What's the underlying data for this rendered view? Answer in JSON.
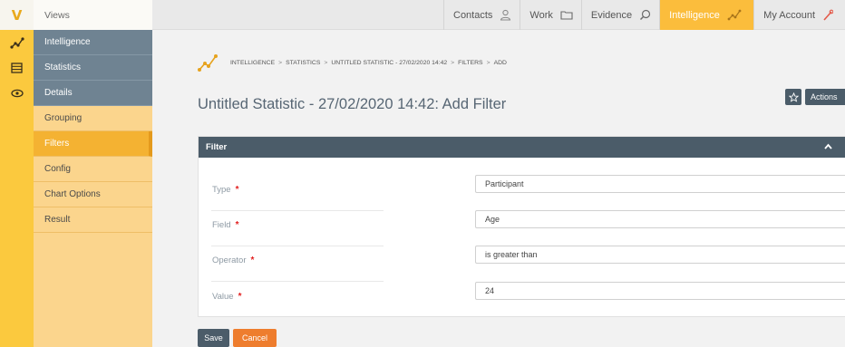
{
  "rail": {
    "logo_text": "V",
    "icons": [
      "logo-icon",
      "intelligence-icon",
      "statistics-icon",
      "details-eye-icon"
    ]
  },
  "nav": {
    "views_label": "Views",
    "items": [
      {
        "label": "Intelligence",
        "state": "section"
      },
      {
        "label": "Statistics",
        "state": "section"
      },
      {
        "label": "Details",
        "state": "section"
      },
      {
        "label": "Grouping",
        "state": "sub"
      },
      {
        "label": "Filters",
        "state": "active"
      },
      {
        "label": "Config",
        "state": "sub"
      },
      {
        "label": "Chart Options",
        "state": "sub"
      },
      {
        "label": "Result",
        "state": "sub"
      }
    ]
  },
  "topnav": {
    "items": [
      {
        "label": "Contacts",
        "icon": "person-icon"
      },
      {
        "label": "Work",
        "icon": "folder-icon"
      },
      {
        "label": "Evidence",
        "icon": "search-icon"
      },
      {
        "label": "Intelligence",
        "icon": "intelligence-icon",
        "highlighted": true
      },
      {
        "label": "My Account",
        "icon": "account-icon"
      }
    ]
  },
  "breadcrumb": {
    "items": [
      "INTELLIGENCE",
      "STATISTICS",
      "UNTITLED STATISTIC - 27/02/2020 14:42",
      "FILTERS",
      "ADD"
    ],
    "separator": ">"
  },
  "page": {
    "title": "Untitled Statistic - 27/02/2020 14:42: Add Filter",
    "actions_label": "Actions"
  },
  "panel": {
    "title": "Filter",
    "required_marker": "*",
    "fields": [
      {
        "label": "Type",
        "value": "Participant",
        "control": "select"
      },
      {
        "label": "Field",
        "value": "Age",
        "control": "select"
      },
      {
        "label": "Operator",
        "value": "is greater than",
        "control": "select"
      },
      {
        "label": "Value",
        "value": "24",
        "control": "input"
      }
    ]
  },
  "buttons": {
    "save": "Save",
    "cancel": "Cancel"
  },
  "colors": {
    "rail": "#fbc93e",
    "nav_dark": "#6f8392",
    "nav_light": "#fbd58d",
    "nav_active": "#f4b232",
    "header_dark": "#4b5c69",
    "accent_orange": "#ee7d2e",
    "required_red": "#e21f1f",
    "topnav_highlight": "#fbbd3c"
  }
}
